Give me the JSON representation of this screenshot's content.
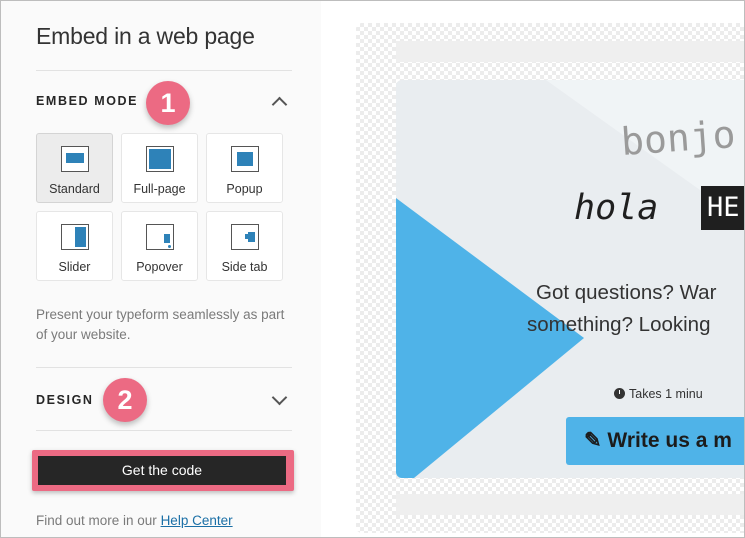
{
  "panel": {
    "title": "Embed in a web page"
  },
  "embed_mode": {
    "title": "EMBED MODE",
    "badge": "1",
    "modes": [
      {
        "label": "Standard",
        "selected": true
      },
      {
        "label": "Full-page"
      },
      {
        "label": "Popup"
      },
      {
        "label": "Slider"
      },
      {
        "label": "Popover"
      },
      {
        "label": "Side tab"
      }
    ],
    "description": "Present your typeform seamlessly as part of your website."
  },
  "design": {
    "title": "DESIGN",
    "badge": "2"
  },
  "get_code_label": "Get the code",
  "help": {
    "prefix": "Find out more in our ",
    "link": "Help Center"
  },
  "preview": {
    "hand_line1": "bonjo",
    "hand_line2": "hola",
    "hand_tag": "HE",
    "question_line1": "Got questions? War",
    "question_line2": "something? Looking",
    "takes": "Takes 1 minu",
    "write_label": "✎ Write us a m"
  },
  "colors": {
    "accent_badge": "#ec6a83",
    "mode_icon_fill": "#2e82b8",
    "preview_triangle": "#4fb3e8",
    "cta_bg": "#262626"
  }
}
